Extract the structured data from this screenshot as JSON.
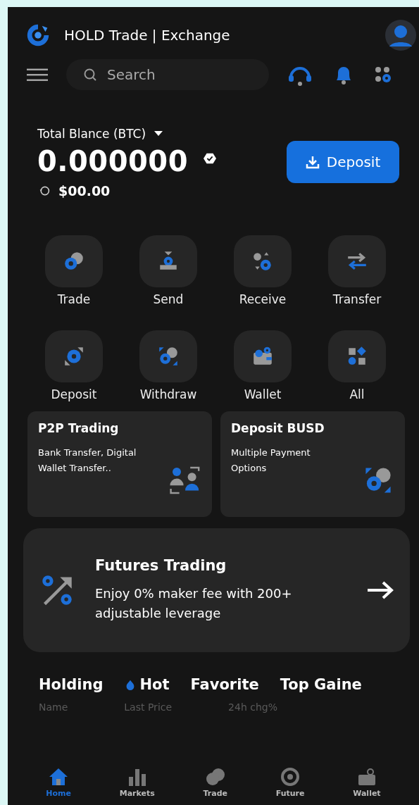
{
  "header": {
    "title": "HOLD Trade | Exchange"
  },
  "search": {
    "placeholder": "Search"
  },
  "balance": {
    "label": "Total Blance (BTC)",
    "amount": "0.000000",
    "fiat": "$00.00",
    "deposit_button": "Deposit"
  },
  "actions": [
    {
      "label": "Trade",
      "kind": "trade"
    },
    {
      "label": "Send",
      "kind": "send"
    },
    {
      "label": "Receive",
      "kind": "receive"
    },
    {
      "label": "Transfer",
      "kind": "transfer"
    },
    {
      "label": "Deposit",
      "kind": "deposit"
    },
    {
      "label": "Withdraw",
      "kind": "withdraw"
    },
    {
      "label": "Wallet",
      "kind": "wallet"
    },
    {
      "label": "All",
      "kind": "all"
    }
  ],
  "promo_cards": [
    {
      "title": "P2P Trading",
      "text": "Bank Transfer, Digital Wallet Transfer..",
      "kind": "p2p"
    },
    {
      "title": "Deposit BUSD",
      "text": "Multiple Payment Options",
      "kind": "withdraw"
    }
  ],
  "futures": {
    "title": "Futures Trading",
    "text": "Enjoy 0% maker fee with 200+ adjustable leverage"
  },
  "market_tabs": [
    {
      "label": "Holding",
      "kind": "plain"
    },
    {
      "label": "Hot",
      "kind": "hot"
    },
    {
      "label": "Favorite",
      "kind": "plain"
    },
    {
      "label": "Top Gaine",
      "kind": "plain"
    }
  ],
  "table": {
    "columns": [
      "Name",
      "Last Price",
      "24h chg%"
    ]
  },
  "nav": [
    {
      "label": "Home",
      "kind": "home",
      "selected": true
    },
    {
      "label": "Markets",
      "kind": "markets",
      "selected": false
    },
    {
      "label": "Trade",
      "kind": "trade",
      "selected": false
    },
    {
      "label": "Future",
      "kind": "future",
      "selected": false
    },
    {
      "label": "Wallet",
      "kind": "wallet",
      "selected": false
    }
  ]
}
